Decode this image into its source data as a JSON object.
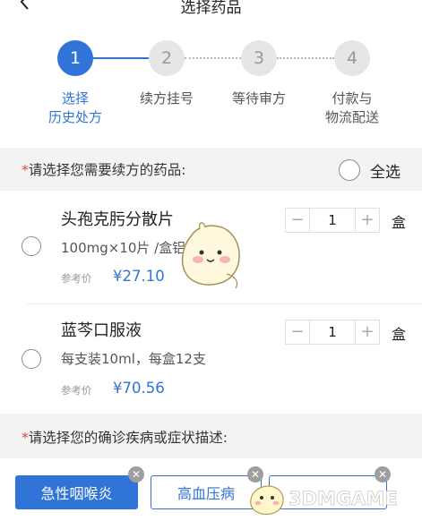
{
  "header": {
    "title": "选择药品"
  },
  "steps": [
    {
      "number": "1",
      "label_line1": "选择",
      "label_line2": "历史处方"
    },
    {
      "number": "2",
      "label_line1": "续方挂号",
      "label_line2": ""
    },
    {
      "number": "3",
      "label_line1": "等待审方",
      "label_line2": ""
    },
    {
      "number": "4",
      "label_line1": "付款与",
      "label_line2": "物流配送"
    }
  ],
  "medicine_section": {
    "required_mark": "*",
    "prompt": "请选择您需要续方的药品:",
    "select_all_label": "全选"
  },
  "products": [
    {
      "name": "头孢克肟分散片",
      "spec": "100mg×10片 /盒铝",
      "ref_label": "参考价",
      "price": "¥27.10",
      "quantity": "1",
      "minus": "−",
      "plus": "+",
      "unit": "盒"
    },
    {
      "name": "蓝芩口服液",
      "spec": "每支装10ml，每盒12支",
      "ref_label": "参考价",
      "price": "¥70.56",
      "quantity": "1",
      "minus": "−",
      "plus": "+",
      "unit": "盒"
    }
  ],
  "diagnosis_section": {
    "required_mark": "*",
    "prompt": "请选择您的确诊疾病或症状描述:"
  },
  "tags": [
    {
      "label": "急性咽喉炎",
      "selected": true
    },
    {
      "label": "高血压病",
      "selected": false
    },
    {
      "label": "",
      "selected": false
    }
  ],
  "icons": {
    "back": "chevron-left-icon",
    "remove": "close-icon"
  },
  "watermark": {
    "text": "3DMGAME"
  },
  "colors": {
    "accent": "#2f74d6",
    "required": "#d9463e",
    "section_bg": "#f3f3f3"
  }
}
